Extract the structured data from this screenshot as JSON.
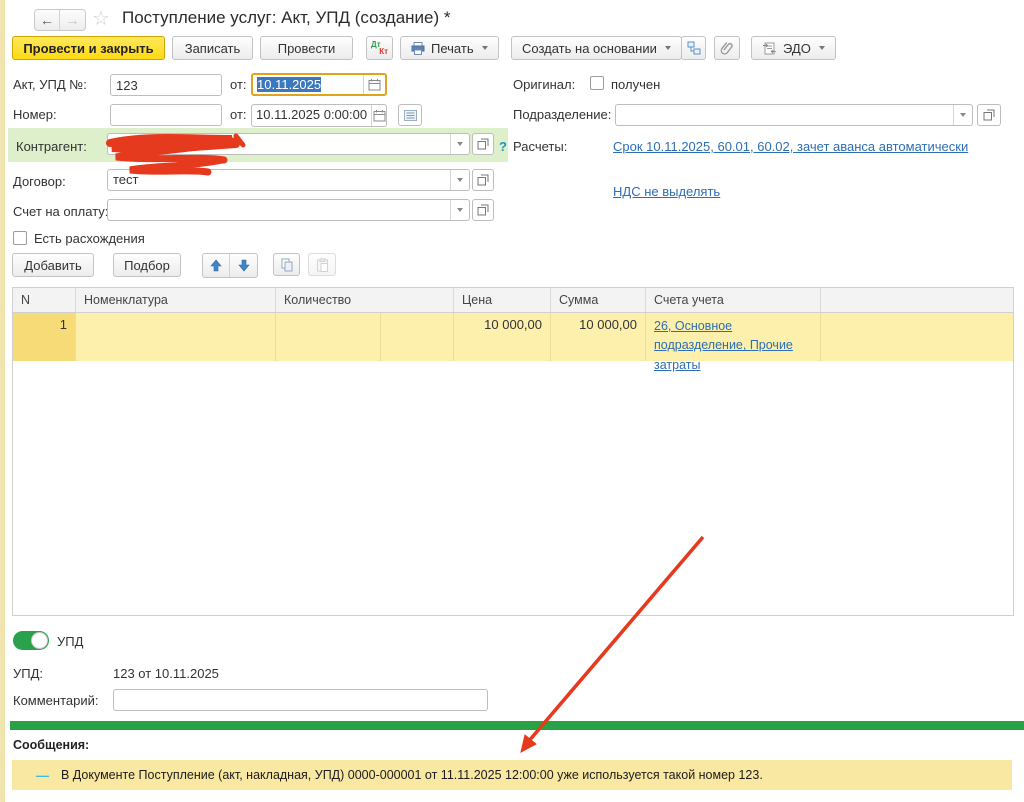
{
  "window": {
    "title": "Поступление услуг: Акт, УПД (создание) *"
  },
  "toolbar": {
    "post_and_close": "Провести и закрыть",
    "save": "Записать",
    "post": "Провести",
    "dt": "Дт",
    "kt": "Кт",
    "print": "Печать",
    "create_based_on": "Создать на основании",
    "edo": "ЭДО"
  },
  "form": {
    "act_number": {
      "label": "Акт, УПД №:",
      "value": "123"
    },
    "act_date": {
      "label": "от:",
      "value": "10.11.2025"
    },
    "number": {
      "label": "Номер:",
      "value": ""
    },
    "reg_date": {
      "label": "от:",
      "value": "10.11.2025  0:00:00"
    },
    "original": {
      "label": "Оригинал:",
      "checkbox_label": "получен"
    },
    "department": {
      "label": "Подразделение:",
      "value": ""
    },
    "counterparty": {
      "label": "Контрагент:",
      "value": ""
    },
    "contract": {
      "label": "Договор:",
      "value": "тест"
    },
    "payment_invoice": {
      "label": "Счет на оплату:",
      "value": ""
    },
    "settlements": {
      "label": "Расчеты:",
      "terms_link": "Срок 10.11.2025, 60.01, 60.02, зачет аванса автоматически",
      "vat_link": "НДС не выделять"
    },
    "has_discrepancies": {
      "label": "Есть расхождения"
    }
  },
  "items_toolbar": {
    "add": "Добавить",
    "pick": "Подбор"
  },
  "items_table": {
    "columns": [
      "N",
      "Номенклатура",
      "Количество",
      "Цена",
      "Сумма",
      "Счета учета"
    ],
    "rows": [
      {
        "n": "1",
        "nomenclature": "",
        "quantity": "",
        "price": "10 000,00",
        "sum": "10 000,00",
        "accounts_link": "26, Основное подразделение, Прочие затраты"
      }
    ]
  },
  "footer": {
    "upd_toggle_label": "УПД",
    "upd_label": "УПД:",
    "upd_value": "123 от 10.11.2025",
    "comment_label": "Комментарий:"
  },
  "messages": {
    "title": "Сообщения:",
    "items": [
      "В Документе Поступление (акт, накладная, УПД) 0000-000001 от 11.11.2025 12:00:00 уже используется такой номер 123."
    ]
  },
  "colors": {
    "accent_yellow": "#ffdd2e",
    "selected_row": "#fdf0ad",
    "selected_row_n": "#f7db77",
    "counterparty_highlight": "#ddefcb",
    "green_splitter": "#28a245",
    "toggle_on": "#2aa14b",
    "link_blue": "#2d6eb5",
    "message_bg": "#f8e8a2",
    "annotation_red": "#e53a1d",
    "selection_blue": "#3c78bd"
  }
}
